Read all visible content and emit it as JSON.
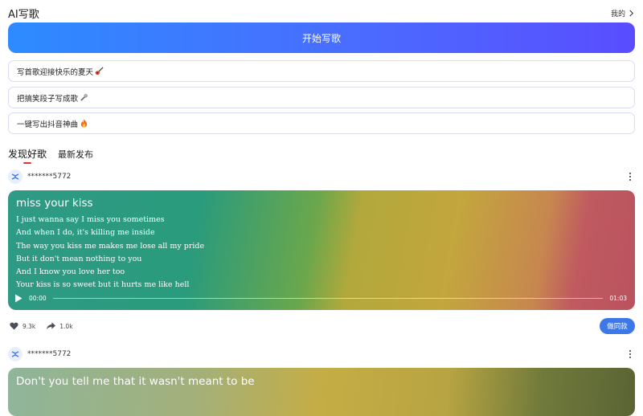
{
  "header": {
    "title": "AI写歌",
    "mine_label": "我的"
  },
  "start_button_label": "开始写歌",
  "prompts": [
    {
      "label": "写首歌迎接快乐的夏天",
      "icon": "guitar-icon"
    },
    {
      "label": "把搞笑段子写成歌",
      "icon": "microphone-icon"
    },
    {
      "label": "一键写出抖音神曲",
      "icon": "fire-icon"
    }
  ],
  "tabs": [
    {
      "label": "发现好歌",
      "active": true
    },
    {
      "label": "最新发布",
      "active": false
    }
  ],
  "songs": [
    {
      "user": "*******5772",
      "title": "miss your kiss",
      "lyrics": [
        "I just wanna say I miss you sometimes",
        "And when I do, it's killing me inside",
        "The way you kiss me makes me lose all my pride",
        "But it don't mean nothing to you",
        "And I know you love her too",
        "Your kiss is so sweet but it hurts me like hell"
      ],
      "current_time": "00:00",
      "duration": "01:03",
      "progress": 0,
      "likes": "9.3k",
      "shares": "1.0k",
      "same_button": "做同款"
    },
    {
      "user": "*******5772",
      "title": "Don't you tell me that it wasn't meant to be"
    }
  ],
  "colors": {
    "accent": "#4a6cff",
    "tab_underline": "#e8303a",
    "same_button": "#3d78e8"
  }
}
